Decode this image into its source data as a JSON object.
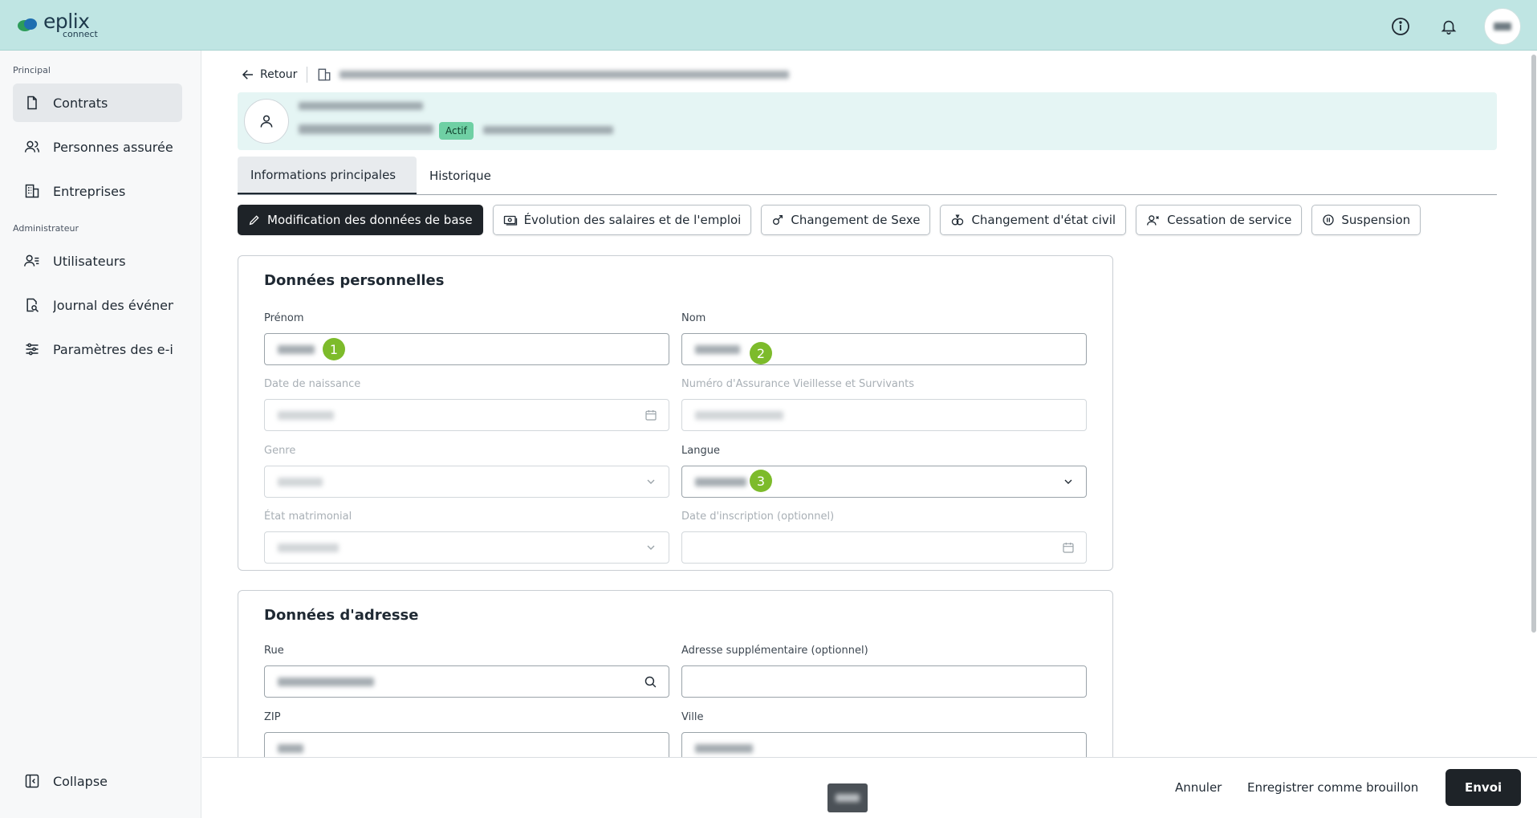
{
  "app": {
    "logo_main": "eplix",
    "logo_sub": "connect",
    "header_icons": [
      "info-icon",
      "bell-icon",
      "user-avatar"
    ]
  },
  "sidebar": {
    "section_principal": "Principal",
    "section_admin": "Administrateur",
    "items": [
      {
        "label": "Contrats",
        "icon": "document-icon",
        "active": true
      },
      {
        "label": "Personnes assurée",
        "icon": "people-icon"
      },
      {
        "label": "Entreprises",
        "icon": "building-icon"
      },
      {
        "label": "Utilisateurs",
        "icon": "users-icon"
      },
      {
        "label": "Journal des événem",
        "icon": "journal-search-icon"
      },
      {
        "label": "Paramètres des e-i",
        "icon": "sliders-icon"
      }
    ],
    "collapse_label": "Collapse"
  },
  "breadcrumb": {
    "back_label": "Retour"
  },
  "person": {
    "status_badge": "Actif"
  },
  "tabs": [
    {
      "label": "Informations principales",
      "active": true
    },
    {
      "label": "Historique"
    }
  ],
  "actions": [
    {
      "label": "Modification des données de base",
      "icon": "pencil-icon",
      "primary": true
    },
    {
      "label": "Évolution des salaires et de l'emploi",
      "icon": "money-icon"
    },
    {
      "label": "Changement de Sexe",
      "icon": "gender-icon"
    },
    {
      "label": "Changement d'état civil",
      "icon": "rings-icon"
    },
    {
      "label": "Cessation de service",
      "icon": "user-remove-icon"
    },
    {
      "label": "Suspension",
      "icon": "pause-icon"
    }
  ],
  "personal": {
    "title": "Données personnelles",
    "prenom_label": "Prénom",
    "nom_label": "Nom",
    "birth_label": "Date de naissance",
    "avs_label": "Numéro d'Assurance Vieillesse et Survivants",
    "genre_label": "Genre",
    "langue_label": "Langue",
    "etat_label": "État matrimonial",
    "inscription_label": "Date d'inscription (optionnel)",
    "marker_1": "1",
    "marker_2": "2",
    "marker_3": "3"
  },
  "address": {
    "title": "Données d'adresse",
    "rue_label": "Rue",
    "extra_label": "Adresse supplémentaire (optionnel)",
    "zip_label": "ZIP",
    "ville_label": "Ville"
  },
  "footer": {
    "cancel": "Annuler",
    "draft": "Enregistrer comme brouillon",
    "send": "Envoi"
  },
  "colors": {
    "header_bg": "#bfe5e3",
    "person_card_bg": "#e5f5f4",
    "badge_bg": "#6fd0a4",
    "marker": "#7dbb2b",
    "primary_button": "#1e2328"
  }
}
